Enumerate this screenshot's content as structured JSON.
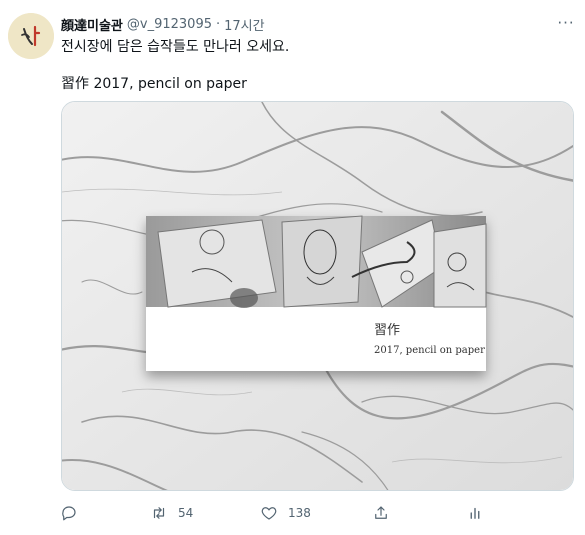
{
  "tweet": {
    "display_name": "顔達미술관",
    "handle": "@v_9123095",
    "separator": "·",
    "time": "17시간",
    "more_label": "···",
    "text_line1": "전시장에 담은 습작들도 만나러 오세요.",
    "text_line2": "習作 2017, pencil on paper",
    "media": {
      "card_title": "習作",
      "card_subtitle": "2017, pencil on paper"
    },
    "actions": {
      "reply": {
        "icon": "reply-icon",
        "count": ""
      },
      "retweet": {
        "icon": "retweet-icon",
        "count": "54"
      },
      "like": {
        "icon": "heart-icon",
        "count": "138"
      },
      "share": {
        "icon": "share-icon",
        "count": ""
      },
      "analytics": {
        "icon": "analytics-icon",
        "count": ""
      }
    }
  },
  "colors": {
    "text_primary": "#0f1419",
    "text_secondary": "#536471",
    "border": "#cfd9de",
    "marble": "#e9e9e9"
  }
}
